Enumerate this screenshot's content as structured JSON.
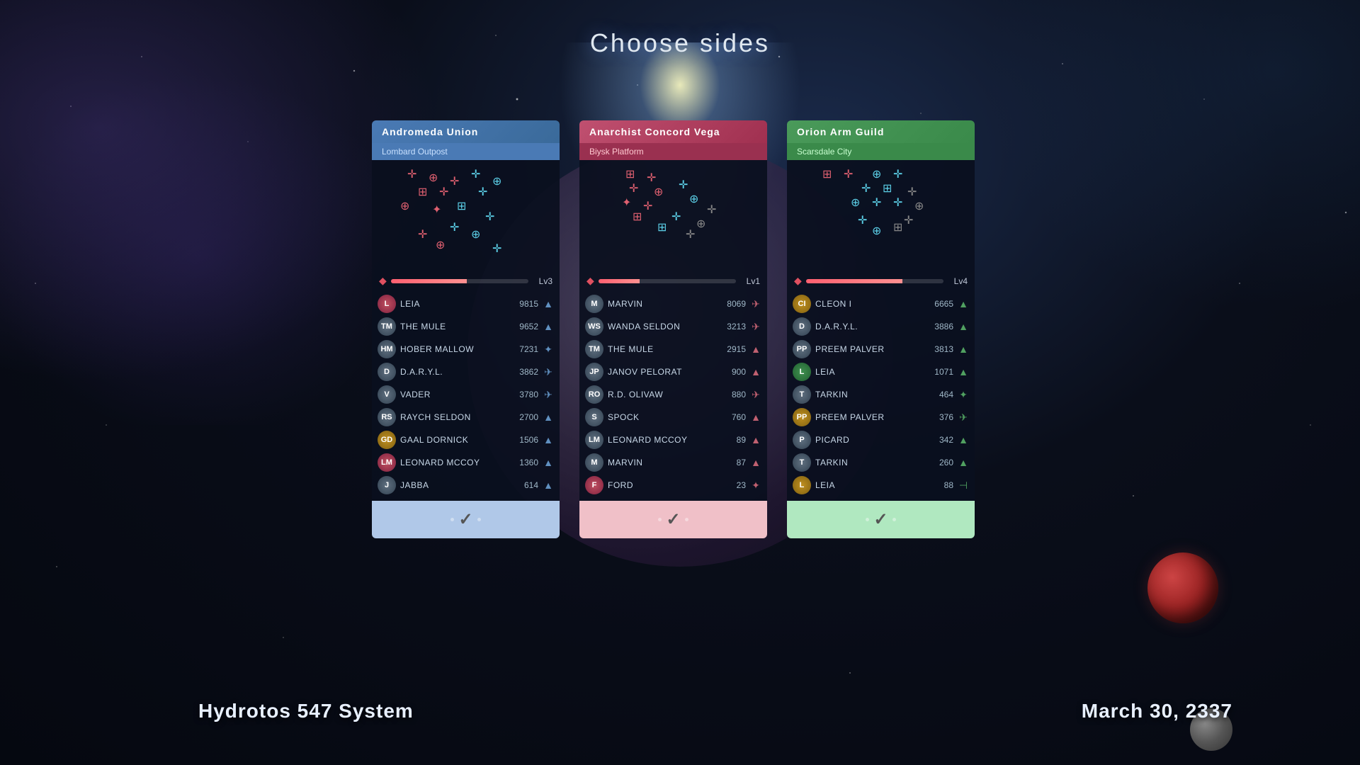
{
  "page": {
    "title": "Choose sides",
    "system": "Hydrotos 547 System",
    "date": "March 30, 2337"
  },
  "factions": [
    {
      "id": "andromeda",
      "name": "Andromeda Union",
      "location": "Lombard Outpost",
      "level": "Lv3",
      "level_fill": 55,
      "theme": "blue",
      "players": [
        {
          "name": "LEIA",
          "score": 9815,
          "avatar": "red",
          "badge": "▲"
        },
        {
          "name": "THE MULE",
          "score": 9652,
          "avatar": "gray",
          "badge": "▲"
        },
        {
          "name": "HOBER MALLOW",
          "score": 7231,
          "avatar": "gray",
          "badge": "✦"
        },
        {
          "name": "D.A.R.Y.L.",
          "score": 3862,
          "avatar": "gray",
          "badge": "✈"
        },
        {
          "name": "VADER",
          "score": 3780,
          "avatar": "gray",
          "badge": "✈"
        },
        {
          "name": "RAYCH SELDON",
          "score": 2700,
          "avatar": "gray",
          "badge": "▲"
        },
        {
          "name": "GAAL DORNICK",
          "score": 1506,
          "avatar": "gold",
          "badge": "▲"
        },
        {
          "name": "LEONARD MCCOY",
          "score": 1360,
          "avatar": "red",
          "badge": "▲"
        },
        {
          "name": "JABBA",
          "score": 614,
          "avatar": "gray",
          "badge": "▲"
        }
      ]
    },
    {
      "id": "anarchist",
      "name": "Anarchist Concord Vega",
      "location": "Biysk Platform",
      "level": "Lv1",
      "level_fill": 30,
      "theme": "red",
      "players": [
        {
          "name": "MARVIN",
          "score": 8069,
          "avatar": "gray",
          "badge": "✈"
        },
        {
          "name": "WANDA SELDON",
          "score": 3213,
          "avatar": "gray",
          "badge": "✈"
        },
        {
          "name": "THE MULE",
          "score": 2915,
          "avatar": "gray",
          "badge": "▲"
        },
        {
          "name": "JANOV PELORAT",
          "score": 900,
          "avatar": "gray",
          "badge": "▲"
        },
        {
          "name": "R.D. OLIVAW",
          "score": 880,
          "avatar": "gray",
          "badge": "✈"
        },
        {
          "name": "SPOCK",
          "score": 760,
          "avatar": "gray",
          "badge": "▲"
        },
        {
          "name": "LEONARD MCCOY",
          "score": 89,
          "avatar": "gray",
          "badge": "▲"
        },
        {
          "name": "MARVIN",
          "score": 87,
          "avatar": "gray",
          "badge": "▲"
        },
        {
          "name": "FORD",
          "score": 23,
          "avatar": "red",
          "badge": "✦"
        }
      ]
    },
    {
      "id": "orion",
      "name": "Orion Arm Guild",
      "location": "Scarsdale City",
      "level": "Lv4",
      "level_fill": 70,
      "theme": "green",
      "players": [
        {
          "name": "CLEON I",
          "score": 6665,
          "avatar": "gold",
          "badge": "▲"
        },
        {
          "name": "D.A.R.Y.L.",
          "score": 3886,
          "avatar": "gray",
          "badge": "▲"
        },
        {
          "name": "PREEM PALVER",
          "score": 3813,
          "avatar": "gray",
          "badge": "▲"
        },
        {
          "name": "LEIA",
          "score": 1071,
          "avatar": "green",
          "badge": "▲"
        },
        {
          "name": "TARKIN",
          "score": 464,
          "avatar": "gray",
          "badge": "✦"
        },
        {
          "name": "PREEM PALVER",
          "score": 376,
          "avatar": "gold",
          "badge": "✈"
        },
        {
          "name": "PICARD",
          "score": 342,
          "avatar": "gray",
          "badge": "▲"
        },
        {
          "name": "TARKIN",
          "score": 260,
          "avatar": "gray",
          "badge": "▲"
        },
        {
          "name": "LEIA",
          "score": 88,
          "avatar": "gold",
          "badge": "⊣"
        }
      ]
    }
  ],
  "ui": {
    "checkmark": "✓"
  }
}
